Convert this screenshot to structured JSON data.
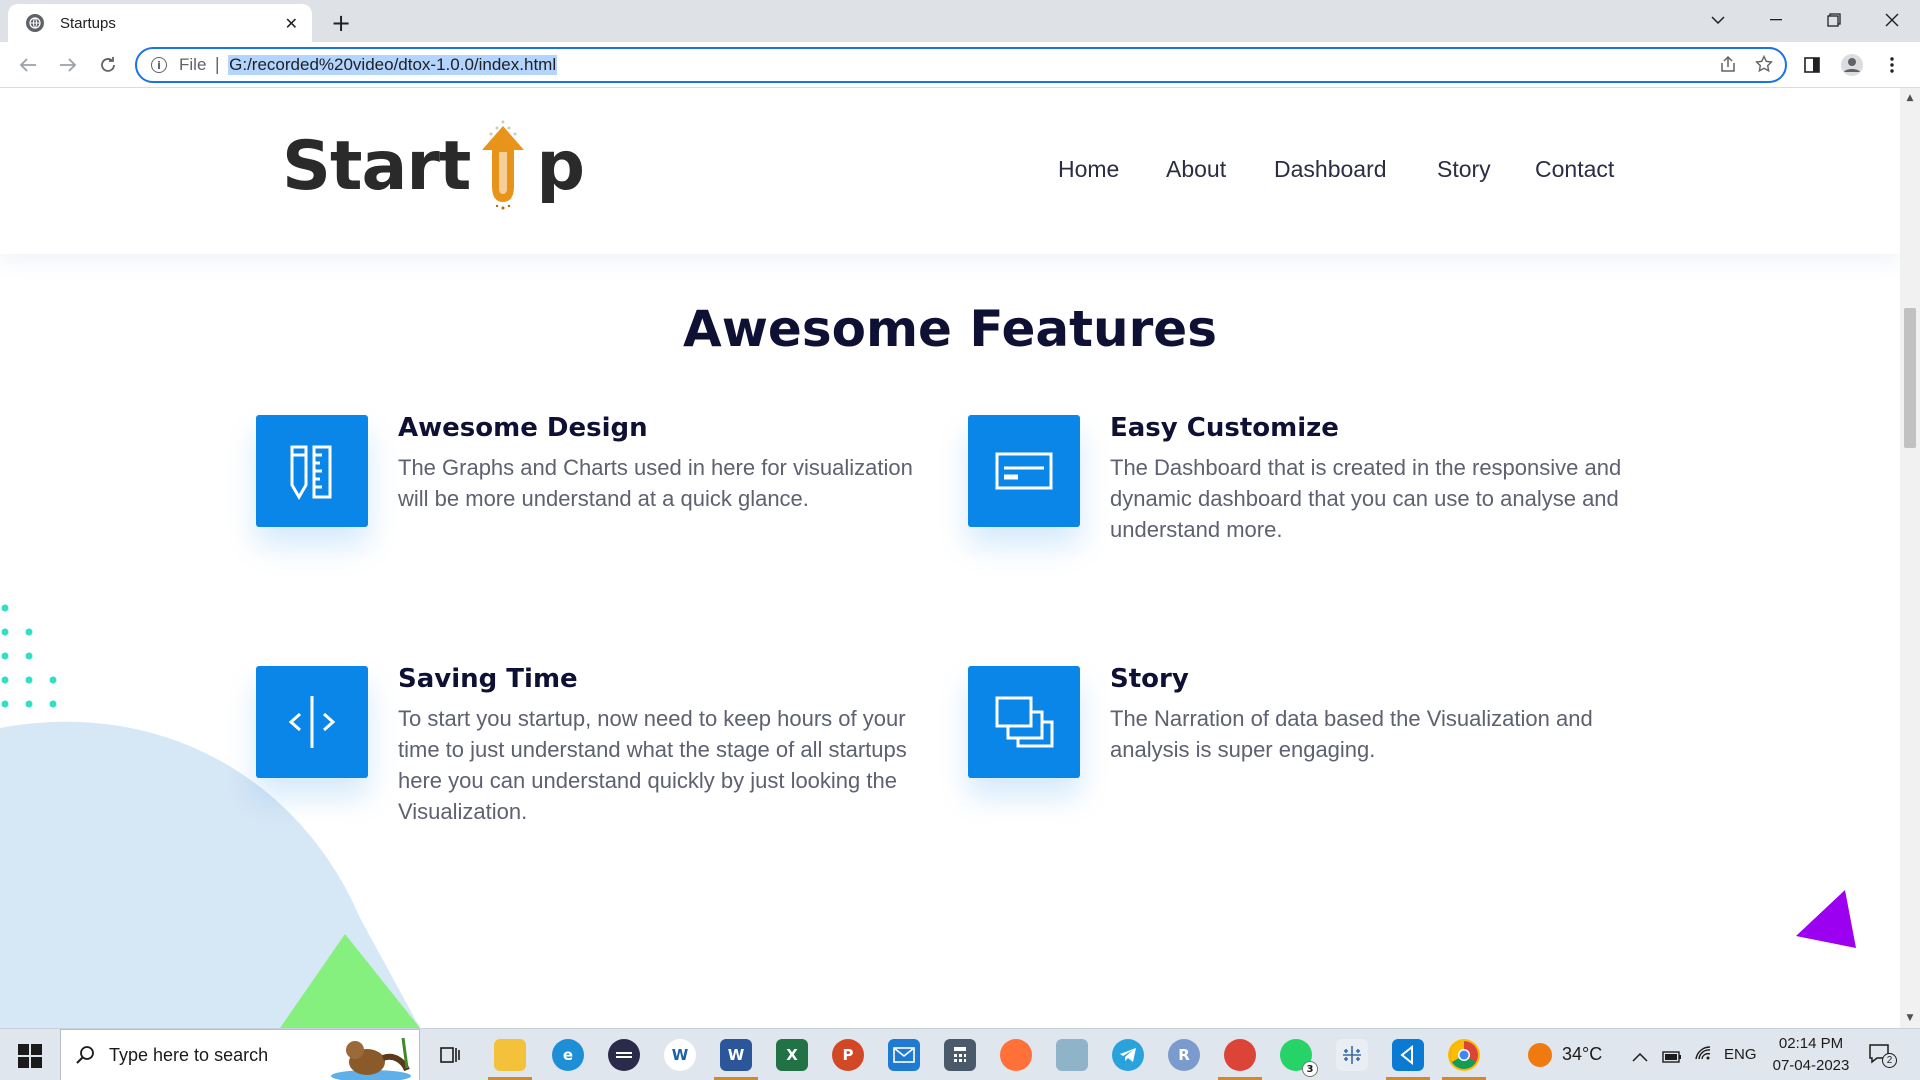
{
  "browser": {
    "tab_title": "Startups",
    "tab_close": "✕",
    "new_tab": "+",
    "scheme": "File",
    "separator": "|",
    "url": "G:/recorded%20video/dtox-1.0.0/index.html"
  },
  "site": {
    "logo_start": "Start",
    "logo_end": "p",
    "nav": [
      "Home",
      "About",
      "Dashboard",
      "Story",
      "Contact"
    ]
  },
  "features": {
    "title": "Awesome Features",
    "items": [
      {
        "title": "Awesome Design",
        "desc": "The Graphs and Charts used in here for visualization will be more understand at a quick glance.",
        "icon": "pencil-ruler-icon"
      },
      {
        "title": "Easy Customize",
        "desc": "The Dashboard that is created in the responsive and dynamic dashboard that you can use to analyse and understand more.",
        "icon": "window-card-icon"
      },
      {
        "title": "Saving Time",
        "desc": "To start you startup, now need to keep hours of your time to just understand what the stage of all startups here you can understand quickly by just looking the Visualization.",
        "icon": "code-divider-icon"
      },
      {
        "title": "Story",
        "desc": "The Narration of data based the Visualization and analysis is super engaging.",
        "icon": "stacked-windows-icon"
      }
    ]
  },
  "taskbar": {
    "search_placeholder": "Type here to search",
    "weather": "34°C",
    "language": "ENG",
    "time": "02:14 PM",
    "date": "07-04-2023",
    "whatsapp_badge": "3",
    "notification_count": "2",
    "r_label": "R"
  },
  "colors": {
    "accent_blue": "#0a85e8",
    "heading_navy": "#0e1133",
    "logo_orange": "#e8941a",
    "decor_purple": "#9b00f0",
    "decor_green": "#7ef07a",
    "decor_teal": "#33e0c8"
  }
}
